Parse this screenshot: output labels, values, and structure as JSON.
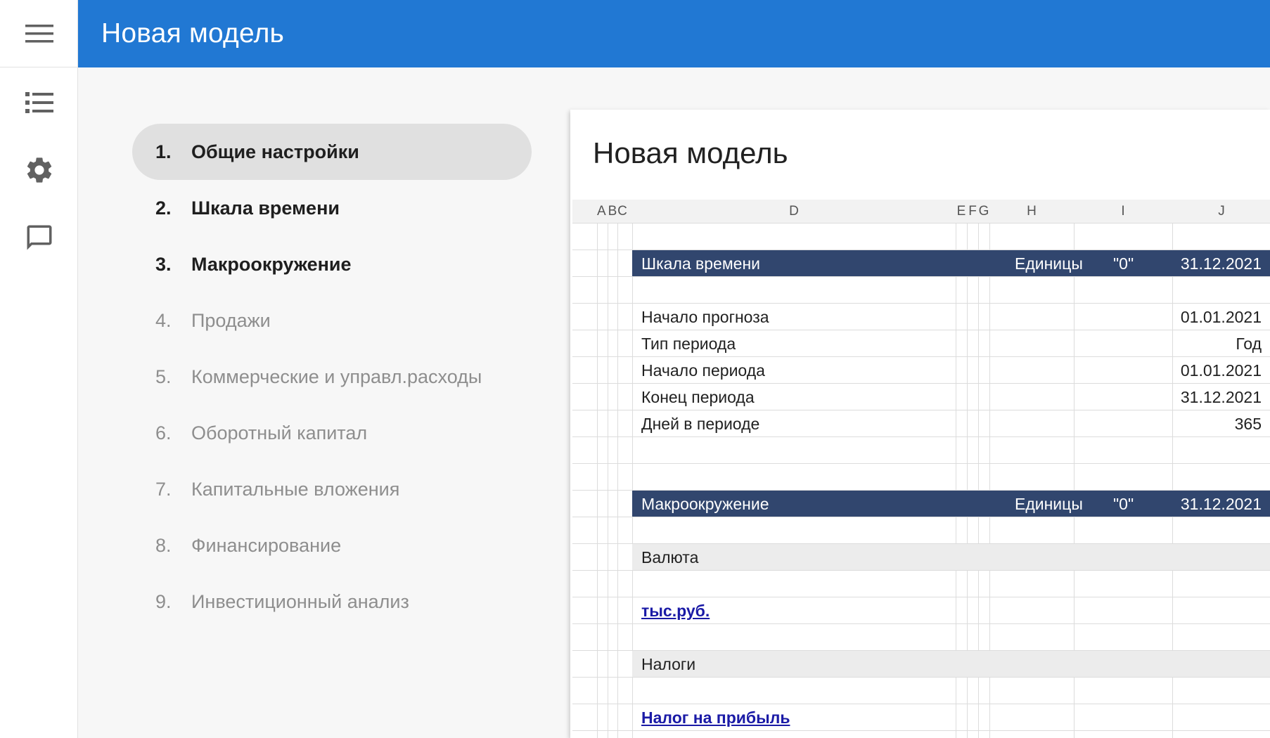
{
  "app": {
    "title": "Новая модель"
  },
  "rail": {
    "items": [
      {
        "name": "list-icon"
      },
      {
        "name": "gear-icon"
      },
      {
        "name": "comment-icon"
      }
    ]
  },
  "steps": [
    {
      "num": "1.",
      "label": "Общие настройки",
      "state": "active"
    },
    {
      "num": "2.",
      "label": "Шкала времени",
      "state": "done"
    },
    {
      "num": "3.",
      "label": "Макроокружение",
      "state": "done"
    },
    {
      "num": "4.",
      "label": "Продажи",
      "state": "pending"
    },
    {
      "num": "5.",
      "label": "Коммерческие и управл.расходы",
      "state": "pending"
    },
    {
      "num": "6.",
      "label": "Оборотный капитал",
      "state": "pending"
    },
    {
      "num": "7.",
      "label": "Капитальные вложения",
      "state": "pending"
    },
    {
      "num": "8.",
      "label": "Финансирование",
      "state": "pending"
    },
    {
      "num": "9.",
      "label": "Инвестиционный анализ",
      "state": "pending"
    }
  ],
  "doc": {
    "title": "Новая модель",
    "columns": [
      "A",
      "B",
      "C",
      "D",
      "E",
      "F",
      "G",
      "H",
      "I",
      "J"
    ],
    "sections": {
      "timeline": {
        "title": "Шкала времени",
        "units": "Единицы",
        "zero": "\"0\"",
        "date": "31.12.2021"
      },
      "macro": {
        "title": "Макроокружение",
        "units": "Единицы",
        "zero": "\"0\"",
        "date": "31.12.2021"
      }
    },
    "timeline_rows": [
      {
        "label": "Начало прогноза",
        "value": "01.01.2021"
      },
      {
        "label": "Тип периода",
        "value": "Год"
      },
      {
        "label": "Начало периода",
        "value": "01.01.2021"
      },
      {
        "label": "Конец периода",
        "value": "31.12.2021"
      },
      {
        "label": "Дней в периоде",
        "value": "365"
      }
    ],
    "macro_rows": {
      "currency_header": "Валюта",
      "currency_link": "тыс.руб.",
      "tax_header": "Налоги",
      "tax_link": "Налог на прибыль"
    }
  },
  "colors": {
    "appbar": "#2178d3",
    "section_band": "#31466e",
    "link": "#1a1aa6"
  }
}
